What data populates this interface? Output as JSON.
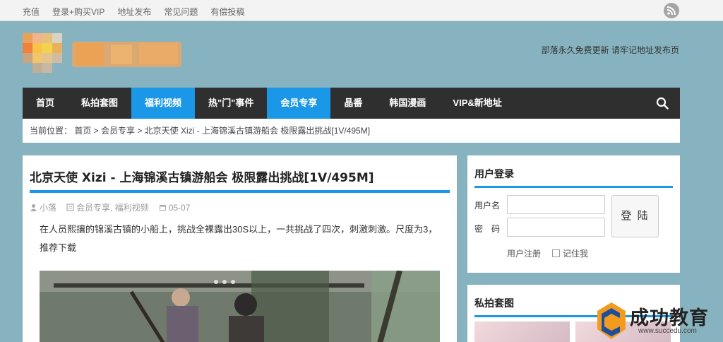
{
  "topbar": {
    "links": [
      "充值",
      "登录+购买VIP",
      "地址发布",
      "常见问题",
      "有偿投稿"
    ]
  },
  "header": {
    "tagline": "部落永久免费更新 请牢记地址发布页"
  },
  "nav": {
    "items": [
      {
        "label": "首页",
        "active": false
      },
      {
        "label": "私拍套图",
        "active": false
      },
      {
        "label": "福利视频",
        "active": true
      },
      {
        "label": "热\"门\"事件",
        "active": false
      },
      {
        "label": "会员专享",
        "active": true
      },
      {
        "label": "晶番",
        "active": false
      },
      {
        "label": "韩国漫画",
        "active": false
      },
      {
        "label": "VIP&新地址",
        "active": false
      }
    ]
  },
  "breadcrumb": {
    "text": "当前位置： 首页 > 会员专享 > 北京天使 Xizi - 上海锦溪古镇游船会 极限露出挑战[1V/495M]"
  },
  "article": {
    "title": "北京天使 Xizi - 上海锦溪古镇游船会 极限露出挑战[1V/495M]",
    "author": "小落",
    "categories": "会员专享, 福利视频",
    "date": "05-07",
    "body": "在人员熙攘的锦溪古镇的小船上，挑战全裸露出30S以上，一共挑战了四次，刺激刺激。尺度为3，推荐下载"
  },
  "login": {
    "title": "用户登录",
    "username_label": "用户名",
    "password_label": "密　码",
    "submit": "登 陆",
    "register": "用户注册",
    "remember": "记住我"
  },
  "photos": {
    "title": "私拍套图"
  },
  "watermark": {
    "name": "成功教育",
    "url": "www.succedu.com"
  },
  "colors": {
    "accent": "#1a97e6",
    "nav_bg": "#2f2f2f",
    "page_bg": "#86b3bf"
  }
}
